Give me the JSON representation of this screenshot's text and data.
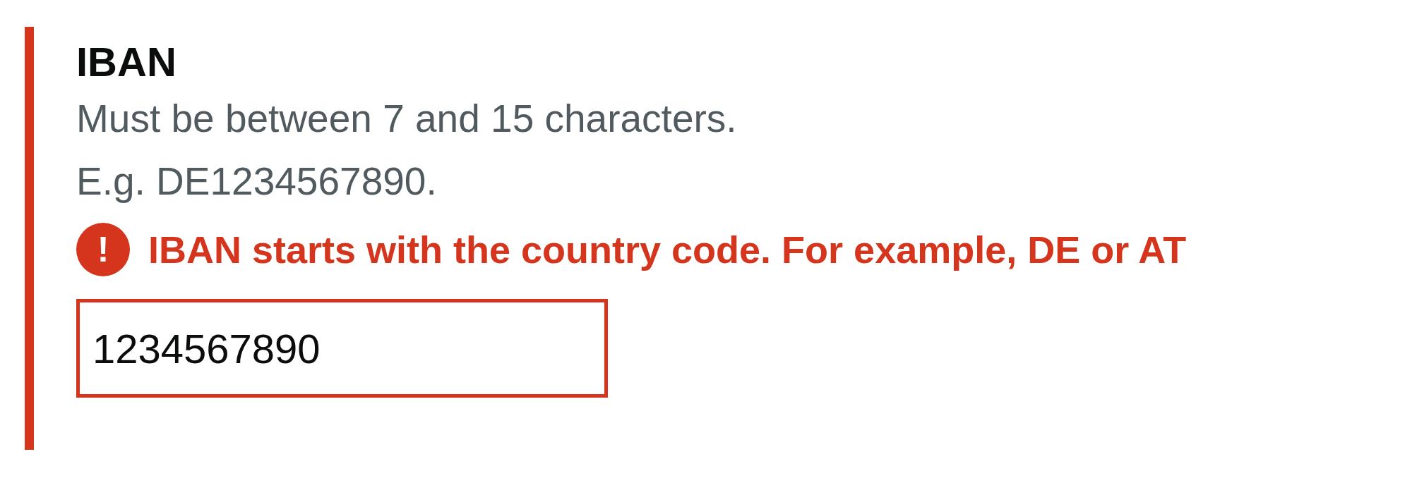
{
  "field": {
    "label": "IBAN",
    "invalid": true,
    "hint_lines": [
      "Must be between 7 and 15 characters.",
      "E.g. DE1234567890."
    ],
    "error": {
      "icon": "!",
      "message": "IBAN starts with the country code. For example, DE or AT"
    },
    "input": {
      "value": "1234567890"
    }
  }
}
